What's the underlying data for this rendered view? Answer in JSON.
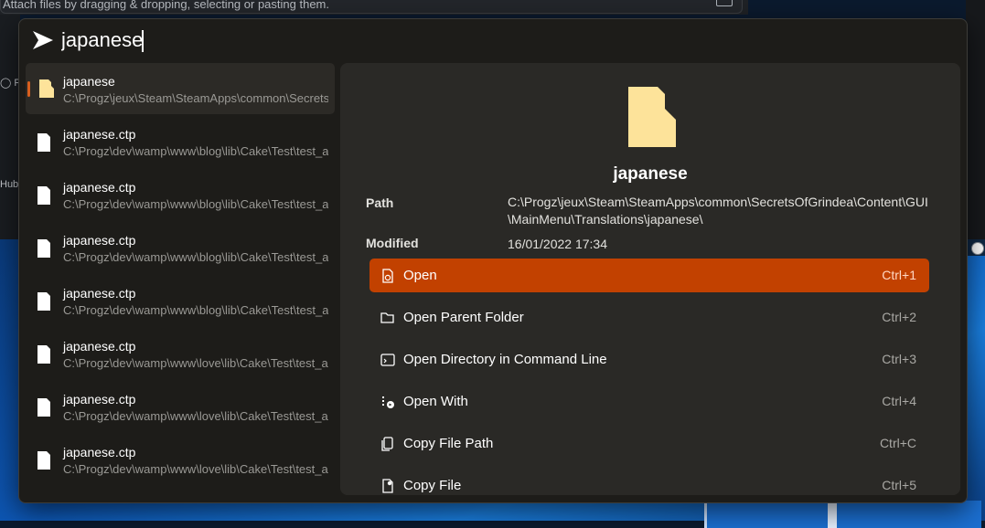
{
  "background": {
    "attach_hint": "Attach files by dragging & dropping, selecting or pasting them.",
    "left_snippet_1": "Re",
    "left_snippet_2": "Hub"
  },
  "search": {
    "query": "japanese",
    "icon": "arrow-right-icon"
  },
  "results": [
    {
      "title": "japanese",
      "path": "C:\\Progz\\jeux\\Steam\\SteamApps\\common\\SecretsOfGrindea",
      "type": "folder",
      "selected": true
    },
    {
      "title": "japanese.ctp",
      "path": "C:\\Progz\\dev\\wamp\\www\\blog\\lib\\Cake\\Test\\test_app",
      "type": "file"
    },
    {
      "title": "japanese.ctp",
      "path": "C:\\Progz\\dev\\wamp\\www\\blog\\lib\\Cake\\Test\\test_app",
      "type": "file"
    },
    {
      "title": "japanese.ctp",
      "path": "C:\\Progz\\dev\\wamp\\www\\blog\\lib\\Cake\\Test\\test_app",
      "type": "file"
    },
    {
      "title": "japanese.ctp",
      "path": "C:\\Progz\\dev\\wamp\\www\\blog\\lib\\Cake\\Test\\test_app",
      "type": "file"
    },
    {
      "title": "japanese.ctp",
      "path": "C:\\Progz\\dev\\wamp\\www\\love\\lib\\Cake\\Test\\test_app",
      "type": "file"
    },
    {
      "title": "japanese.ctp",
      "path": "C:\\Progz\\dev\\wamp\\www\\love\\lib\\Cake\\Test\\test_app",
      "type": "file"
    },
    {
      "title": "japanese.ctp",
      "path": "C:\\Progz\\dev\\wamp\\www\\love\\lib\\Cake\\Test\\test_app",
      "type": "file"
    }
  ],
  "preview": {
    "name": "japanese",
    "path_label": "Path",
    "path_value": "C:\\Progz\\jeux\\Steam\\SteamApps\\common\\SecretsOfGrindea\\Content\\GUI\\MainMenu\\Translations\\japanese\\",
    "modified_label": "Modified",
    "modified_value": "16/01/2022 17:34"
  },
  "actions": [
    {
      "label": "Open",
      "shortcut": "Ctrl+1",
      "icon": "open-file-icon",
      "primary": true
    },
    {
      "label": "Open Parent Folder",
      "shortcut": "Ctrl+2",
      "icon": "folder-open-icon"
    },
    {
      "label": "Open Directory in Command Line",
      "shortcut": "Ctrl+3",
      "icon": "terminal-icon"
    },
    {
      "label": "Open With",
      "shortcut": "Ctrl+4",
      "icon": "open-with-icon"
    },
    {
      "label": "Copy File Path",
      "shortcut": "Ctrl+C",
      "icon": "copy-icon"
    },
    {
      "label": "Copy File",
      "shortcut": "Ctrl+5",
      "icon": "copy-file-icon"
    }
  ],
  "colors": {
    "accent": "#c24100",
    "selection_bar": "#d85f1e",
    "folder_yellow": "#fde39a"
  }
}
